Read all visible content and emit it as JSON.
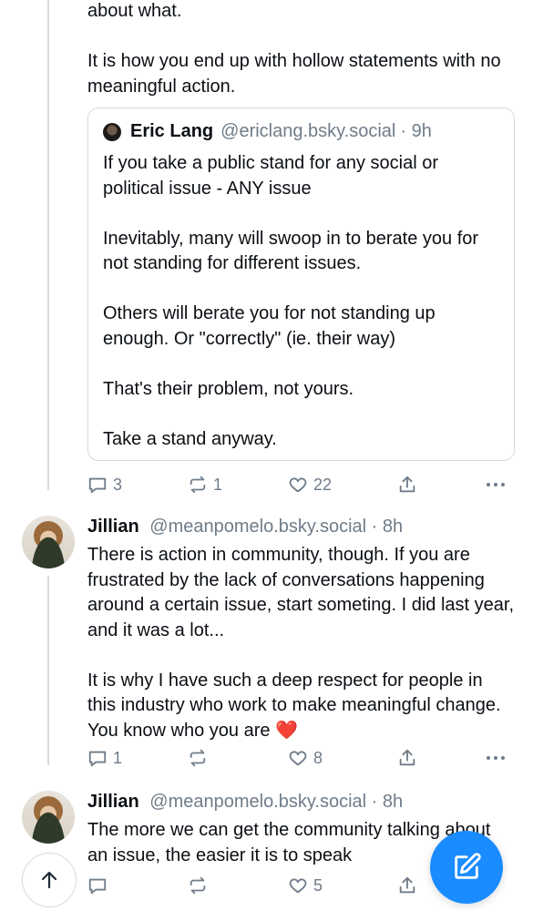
{
  "post1": {
    "text": "about what.\n\nIt is how you end up with hollow statements with no meaningful action.",
    "quote": {
      "author_name": "Eric Lang",
      "author_handle": "@ericlang.bsky.social",
      "time": "· 9h",
      "text": "If you take a public stand for any social or political issue - ANY issue\n\nInevitably, many will swoop in to berate you for not standing for different issues.\n\nOthers will berate you for not standing up enough. Or \"correctly\" (ie. their way)\n\nThat's their problem, not yours.\n\nTake a stand anyway."
    },
    "actions": {
      "replies": "3",
      "reposts": "1",
      "likes": "22"
    }
  },
  "post2": {
    "author_name": "Jillian",
    "author_handle": "@meanpomelo.bsky.social",
    "time": "· 8h",
    "text": "There is action in community, though. If you are frustrated by the lack of conversations happening around a certain issue, start someting. I did last year, and it was a lot...\n\nIt is why I have such a deep respect for people in this industry who work to make meaningful change. You know who you are ❤️",
    "actions": {
      "replies": "1",
      "reposts": "",
      "likes": "8"
    }
  },
  "post3": {
    "author_name": "Jillian",
    "author_handle": "@meanpomelo.bsky.social",
    "time": "· 8h",
    "text": "The more we can get the community talking about an issue, the easier it is to speak",
    "actions": {
      "replies": "",
      "reposts": "",
      "likes": "5"
    }
  },
  "icons": {
    "reply": "reply-icon",
    "repost": "repost-icon",
    "like": "heart-icon",
    "share": "share-icon",
    "more": "more-icon",
    "compose": "compose-icon",
    "scroll_top": "arrow-up-icon"
  },
  "colors": {
    "accent": "#1a8cff",
    "muted": "#6f7c89",
    "border": "#d4dbe2"
  }
}
